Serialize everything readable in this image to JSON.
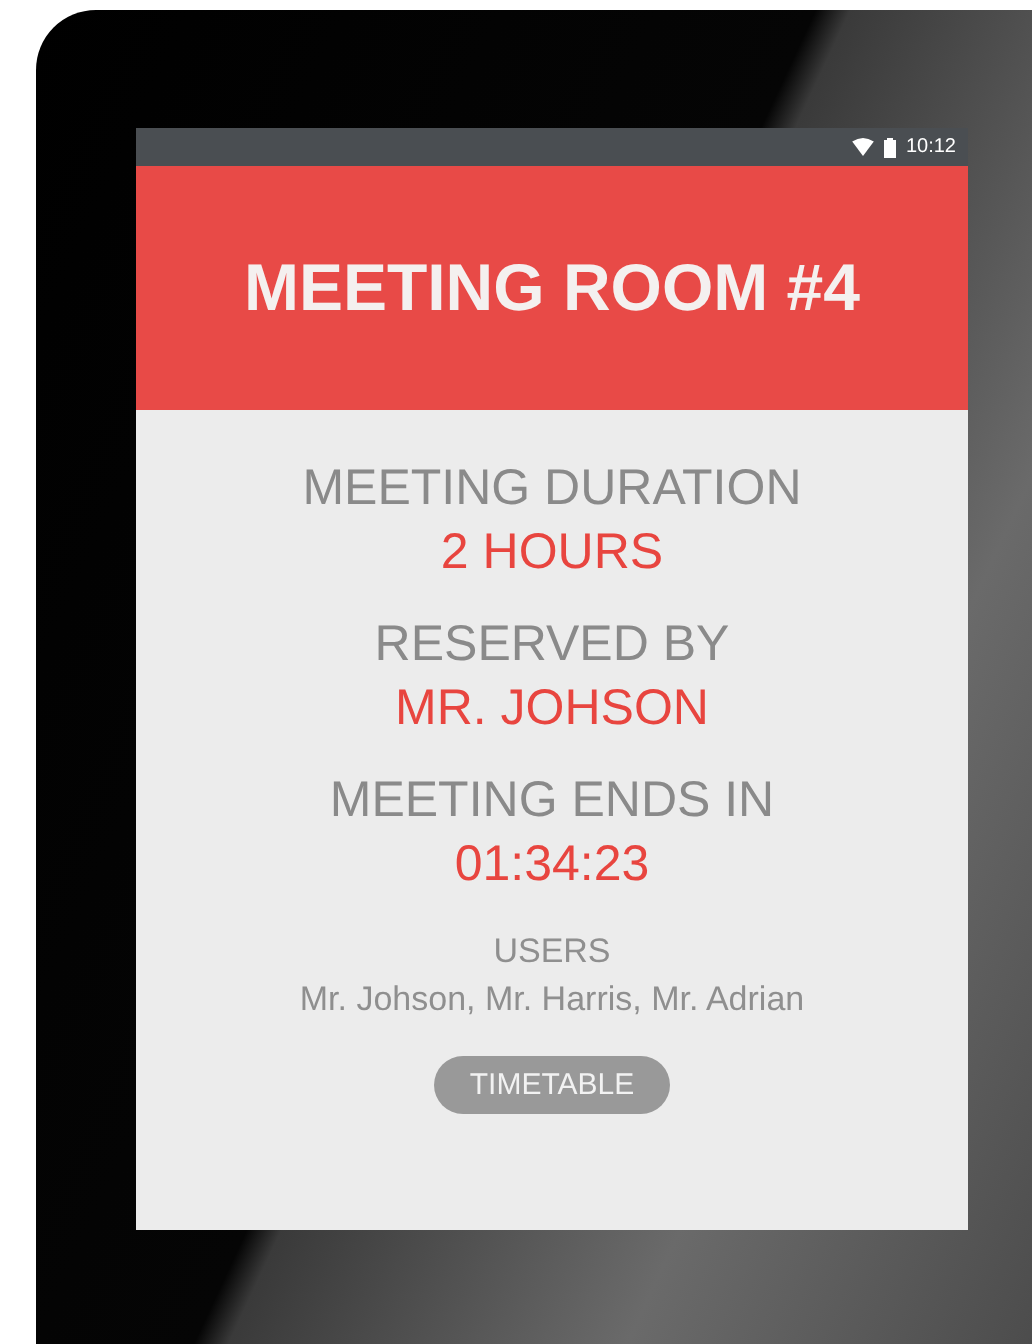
{
  "status_bar": {
    "time": "10:12"
  },
  "header": {
    "title": "MEETING ROOM #4"
  },
  "details": [
    {
      "label": "MEETING DURATION",
      "value": "2 HOURS"
    },
    {
      "label": "RESERVED BY",
      "value": "MR. JOHSON"
    },
    {
      "label": "MEETING ENDS IN",
      "value": "01:34:23"
    }
  ],
  "users": {
    "label": "USERS",
    "names": "Mr. Johson, Mr. Harris, Mr. Adrian"
  },
  "button": {
    "label": "TIMETABLE"
  }
}
